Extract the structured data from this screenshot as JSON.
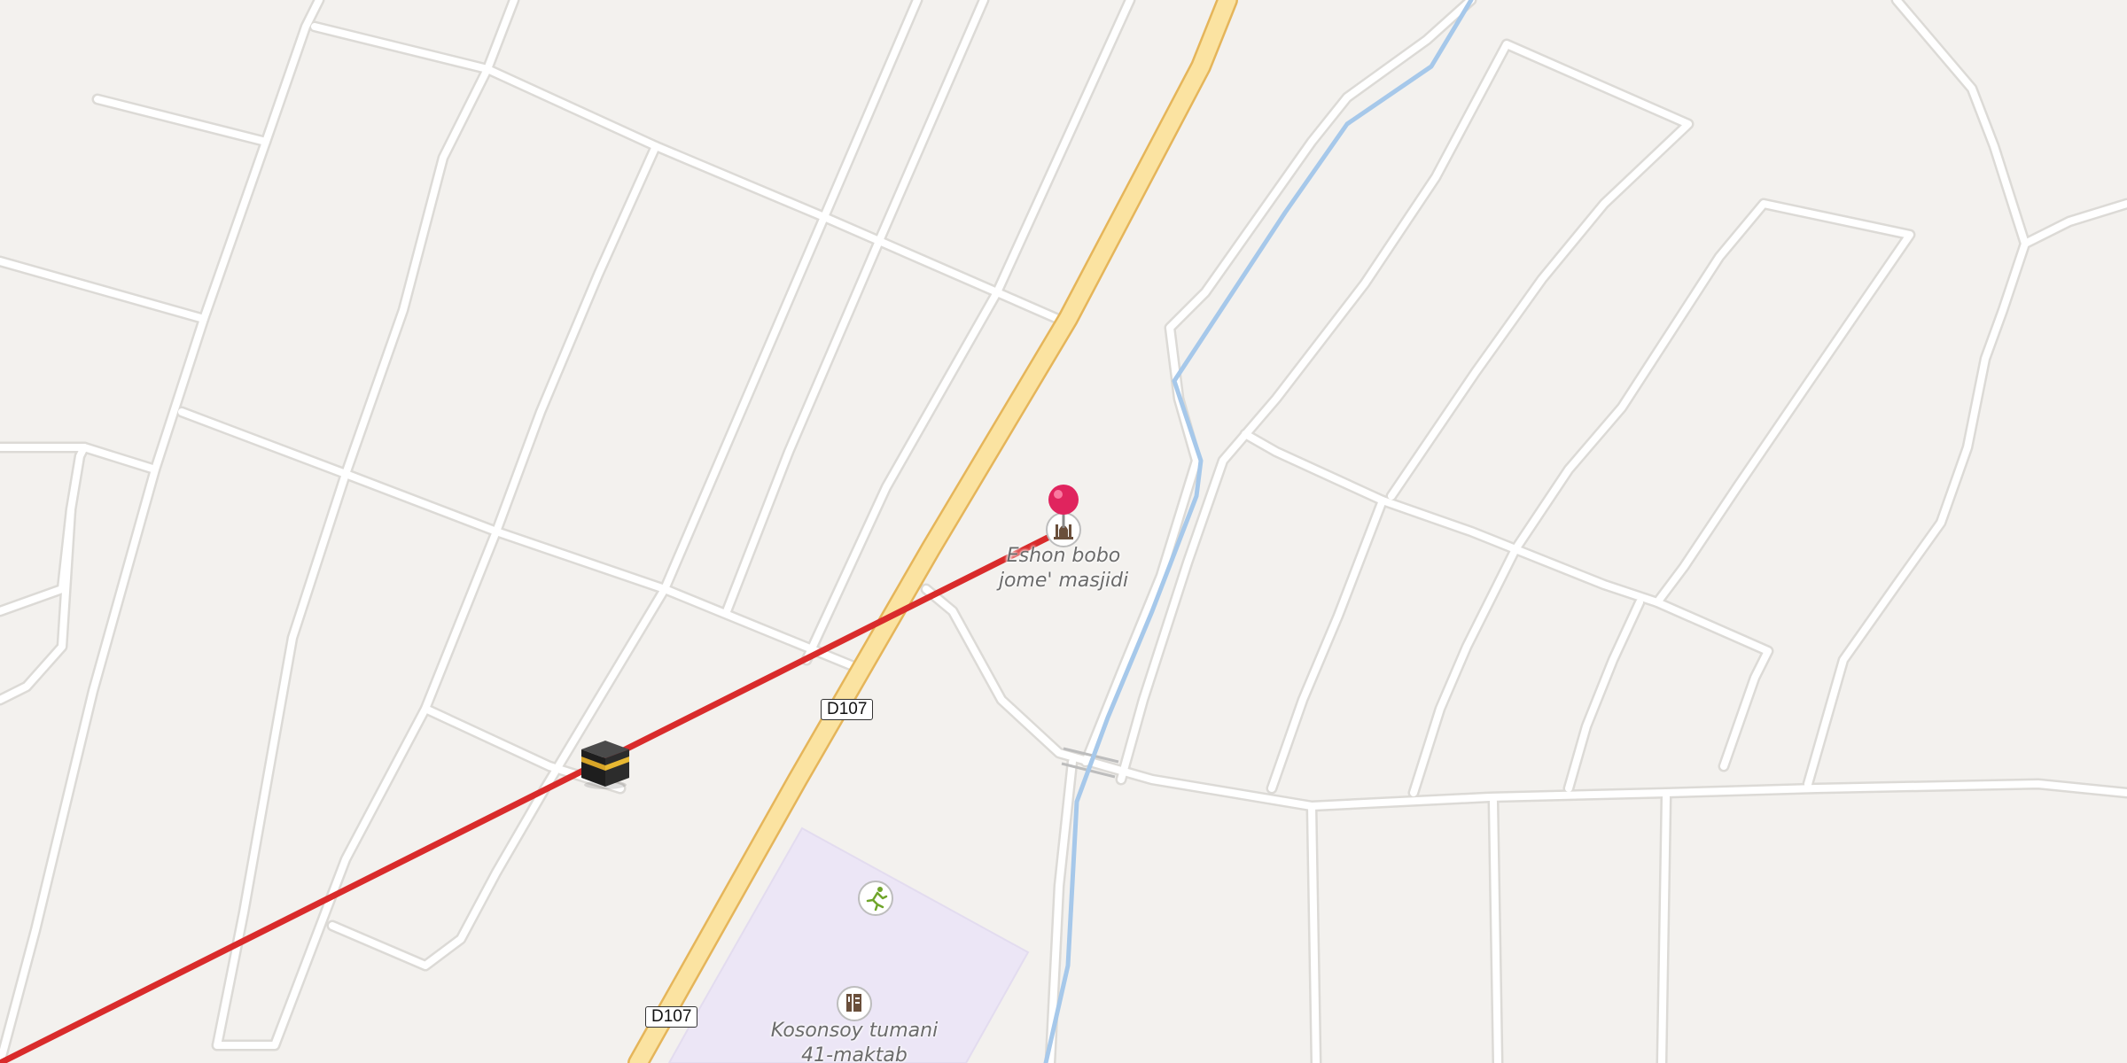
{
  "map": {
    "colors": {
      "background": "#f3f1ee",
      "minor_road": "#ffffff",
      "minor_road_casing": "#dcdad6",
      "highway": "#fbe3a1",
      "highway_casing": "#e5b55a",
      "waterway": "#a6c8ea",
      "school_area": "#ece6f6",
      "route_line": "#d92b2b",
      "pin": "#e0245e"
    },
    "road_labels": [
      {
        "id": "d107-upper",
        "text": "D107"
      },
      {
        "id": "d107-lower",
        "text": "D107"
      }
    ],
    "pois": [
      {
        "id": "mosque",
        "icon": "mosque-icon",
        "name_line1": "Eshon bobo",
        "name_line2": "jome' masjidi"
      },
      {
        "id": "school",
        "icon": "school-icon",
        "name_line1": "Kosonsoy tumani",
        "name_line2": "41-maktab"
      },
      {
        "id": "sports",
        "icon": "sports-icon"
      }
    ],
    "markers": {
      "destination_pin": "pin-icon",
      "qibla_marker": "kaaba-icon"
    }
  }
}
